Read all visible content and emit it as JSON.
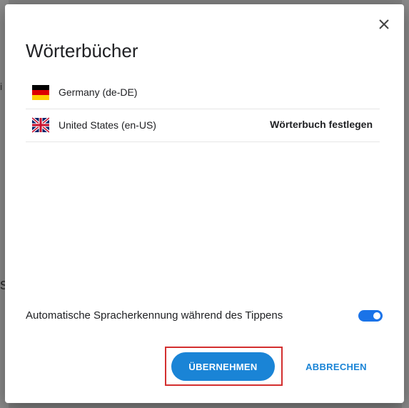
{
  "dialog": {
    "title": "Wörterbücher",
    "close_icon": "close-icon",
    "languages": [
      {
        "label": "Germany (de-DE)",
        "flag": "germany-flag-icon",
        "action": ""
      },
      {
        "label": "United States (en-US)",
        "flag": "uk-flag-icon",
        "action": "Wörterbuch festlegen"
      }
    ],
    "auto_detect": {
      "label": "Automatische Spracherkennung während des Tippens",
      "enabled": true
    },
    "buttons": {
      "apply": "ÜBERNEHMEN",
      "cancel": "ABBRECHEN"
    }
  },
  "background_fragments": {
    "left_text_1": "i",
    "left_text_2": "s"
  },
  "colors": {
    "accent": "#1a84d6",
    "toggle_on": "#1a73e8",
    "highlight": "#d32f2f"
  }
}
